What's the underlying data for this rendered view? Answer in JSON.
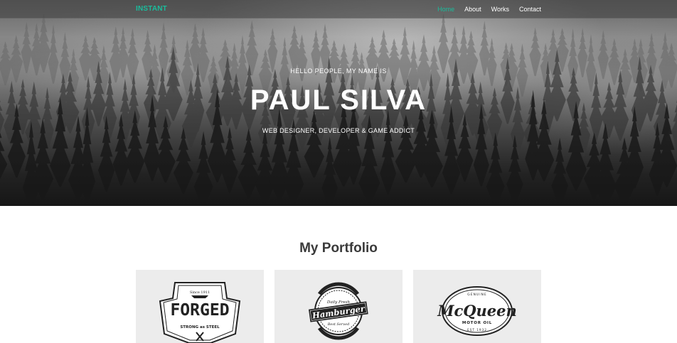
{
  "nav": {
    "brand": "INSTANT",
    "links": [
      {
        "label": "Home",
        "active": true
      },
      {
        "label": "About",
        "active": false
      },
      {
        "label": "Works",
        "active": false
      },
      {
        "label": "Contact",
        "active": false
      }
    ]
  },
  "hero": {
    "greeting": "HELLO PEOPLE, MY NAME IS",
    "name": "PAUL SILVA",
    "tagline": "WEB DESIGNER, DEVELOPER & GAME ADDICT"
  },
  "portfolio": {
    "title": "My Portfolio",
    "items": [
      {
        "logo_text": "FORGED",
        "sub_text": "STRONG as STEEL",
        "top_text": "Since 1911"
      },
      {
        "logo_text": "Hamburger",
        "top_text": "Daily Fresh",
        "bottom_text": "Best Served"
      },
      {
        "logo_text": "McQueen",
        "top_text": "GENUINE",
        "sub_text": "MOTOR OIL",
        "bottom_text": "EST 1932"
      }
    ]
  },
  "colors": {
    "accent": "#1abc9c",
    "card_bg": "#ececec",
    "nav_bg": "#3c3c3c"
  }
}
